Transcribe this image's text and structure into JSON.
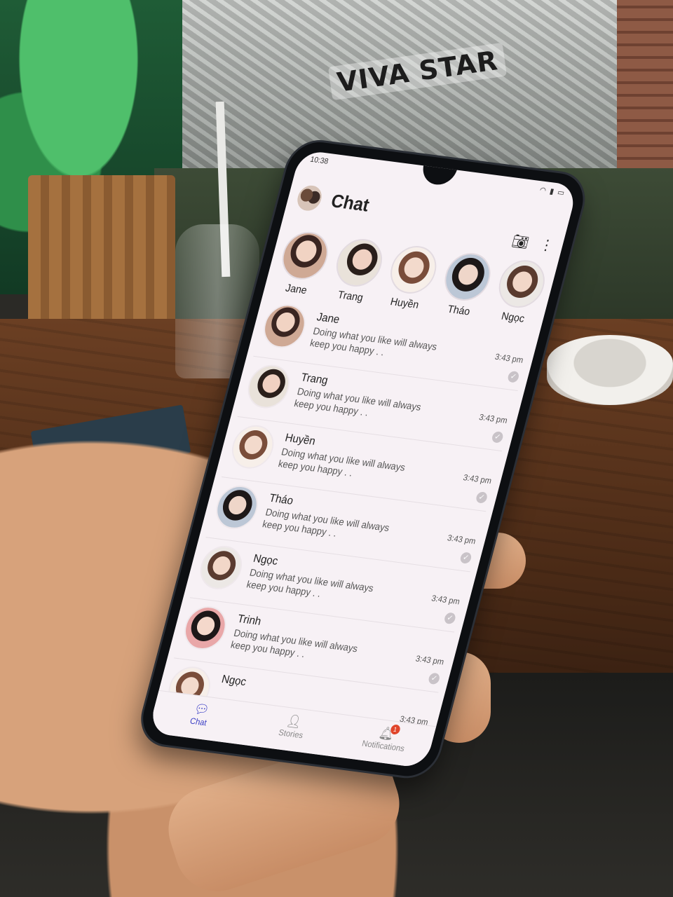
{
  "status": {
    "time": "10:38"
  },
  "header": {
    "title": "Chat",
    "actions": [
      "camera-icon",
      "more-vertical-icon"
    ]
  },
  "stories": [
    {
      "name": "Jane"
    },
    {
      "name": "Trang"
    },
    {
      "name": "Huyền"
    },
    {
      "name": "Tháo"
    },
    {
      "name": "Ngọc"
    }
  ],
  "chats": [
    {
      "name": "Jane",
      "message": "Doing what you like will always keep you happy . .",
      "time": "3:43 pm",
      "read": true
    },
    {
      "name": "Trang",
      "message": "Doing what you like will always keep you happy . .",
      "time": "3:43 pm",
      "read": true
    },
    {
      "name": "Huyền",
      "message": "Doing what you like will always keep you happy . .",
      "time": "3:43 pm",
      "read": true
    },
    {
      "name": "Tháo",
      "message": "Doing what you like will always keep you happy . .",
      "time": "3:43 pm",
      "read": true
    },
    {
      "name": "Ngọc",
      "message": "Doing what you like will always keep you happy . .",
      "time": "3:43 pm",
      "read": true
    },
    {
      "name": "Trinh",
      "message": "Doing what you like will always keep you happy . .",
      "time": "3:43 pm",
      "read": true
    },
    {
      "name": "Ngọc",
      "message": "",
      "time": "3:43 pm",
      "read": false
    }
  ],
  "tabs": [
    {
      "label": "Chat",
      "icon": "chat-bubble-icon",
      "active": true
    },
    {
      "label": "Stories",
      "icon": "person-icon",
      "active": false
    },
    {
      "label": "Notifications",
      "icon": "bell-icon",
      "active": false,
      "badge": "1"
    }
  ],
  "colors": {
    "accent": "#3a3ec5",
    "badge": "#e0452b",
    "screen_bg": "#f7f1f5"
  },
  "background": {
    "mural_text": "VIVA STAR"
  }
}
